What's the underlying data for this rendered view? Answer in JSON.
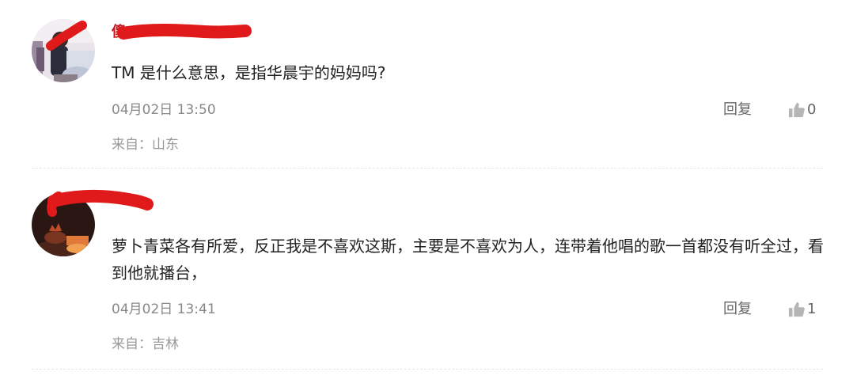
{
  "colors": {
    "username": "#c8161d",
    "content": "#222222",
    "meta": "#888888",
    "location": "#999999",
    "action": "#666666",
    "like_icon": "#b5b5b5",
    "redaction": "#e01a1a",
    "divider": "#e6e6e6"
  },
  "comments": [
    {
      "username": "傻...t",
      "content": "TM 是什么意思，是指华晨宇的妈妈吗?",
      "time": "04月02日 13:50",
      "reply_label": "回复",
      "like_count": "0",
      "location": "来自：山东",
      "avatar_icon": "user-avatar-photo"
    },
    {
      "username": "",
      "content": "萝卜青菜各有所爱，反正我是不喜欢这斯，主要是不喜欢为人，连带着他唱的歌一首都没有听全过，看到他就播台，",
      "time": "04月02日 13:41",
      "reply_label": "回复",
      "like_count": "1",
      "location": "来自：吉林",
      "avatar_icon": "user-avatar-photo"
    }
  ],
  "icons": {
    "like": "thumbs-up-icon"
  }
}
